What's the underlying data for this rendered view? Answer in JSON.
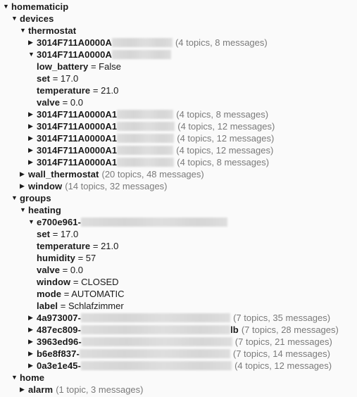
{
  "icons": {
    "expanded": "▼",
    "collapsed": "▶"
  },
  "colors": {
    "background": "#fafafa",
    "text": "#1a1a1a",
    "meta": "#7a7a7a"
  },
  "tree": {
    "root": {
      "label": "homematicip",
      "expanded": true
    },
    "devices": {
      "label": "devices",
      "expanded": true
    },
    "thermostat": {
      "label": "thermostat",
      "expanded": true
    },
    "thermostat_items": [
      {
        "label": "3014F711A0000A",
        "meta": "(4 topics, 8 messages)",
        "expanded": false
      },
      {
        "label": "3014F711A0000A",
        "meta": "",
        "expanded": true
      }
    ],
    "thermostat_props": [
      {
        "key": "low_battery",
        "value": "= False"
      },
      {
        "key": "set",
        "value": "= 17.0"
      },
      {
        "key": "temperature",
        "value": "= 21.0"
      },
      {
        "key": "valve",
        "value": "= 0.0"
      }
    ],
    "thermostat_more": [
      {
        "label": "3014F711A0000A1",
        "meta": "(4 topics, 8 messages)"
      },
      {
        "label": "3014F711A0000A1",
        "meta": "(4 topics, 12 messages)"
      },
      {
        "label": "3014F711A0000A1",
        "meta": "(4 topics, 12 messages)"
      },
      {
        "label": "3014F711A0000A1",
        "meta": "(4 topics, 12 messages)"
      },
      {
        "label": "3014F711A0000A1",
        "meta": "(4 topics, 8 messages)"
      }
    ],
    "wall_thermostat": {
      "label": "wall_thermostat",
      "meta": "(20 topics, 48 messages)"
    },
    "window": {
      "label": "window",
      "meta": "(14 topics, 32 messages)"
    },
    "groups": {
      "label": "groups",
      "expanded": true
    },
    "heating": {
      "label": "heating",
      "expanded": true
    },
    "heating_group": {
      "label": "e700e961-",
      "expanded": true
    },
    "heating_props": [
      {
        "key": "set",
        "value": "= 17.0"
      },
      {
        "key": "temperature",
        "value": "= 21.0"
      },
      {
        "key": "humidity",
        "value": "= 57"
      },
      {
        "key": "valve",
        "value": "= 0.0"
      },
      {
        "key": "window",
        "value": "= CLOSED"
      },
      {
        "key": "mode",
        "value": "= AUTOMATIC"
      },
      {
        "key": "label",
        "value": "= Schlafzimmer"
      }
    ],
    "heating_more": [
      {
        "label": "4a973007-",
        "suffix": "",
        "meta": "(7 topics, 35 messages)"
      },
      {
        "label": "487ec809-",
        "suffix": "lb",
        "meta": "(7 topics, 28 messages)"
      },
      {
        "label": "3963ed96-",
        "suffix": "",
        "meta": "(7 topics, 21 messages)"
      },
      {
        "label": "b6e8f837-",
        "suffix": "",
        "meta": "(7 topics, 14 messages)"
      },
      {
        "label": "0a3e1e45-",
        "suffix": "",
        "meta": "(4 topics, 12 messages)"
      }
    ],
    "home": {
      "label": "home",
      "expanded": true
    },
    "alarm": {
      "label": "alarm",
      "meta": "(1 topic, 3 messages)"
    }
  }
}
